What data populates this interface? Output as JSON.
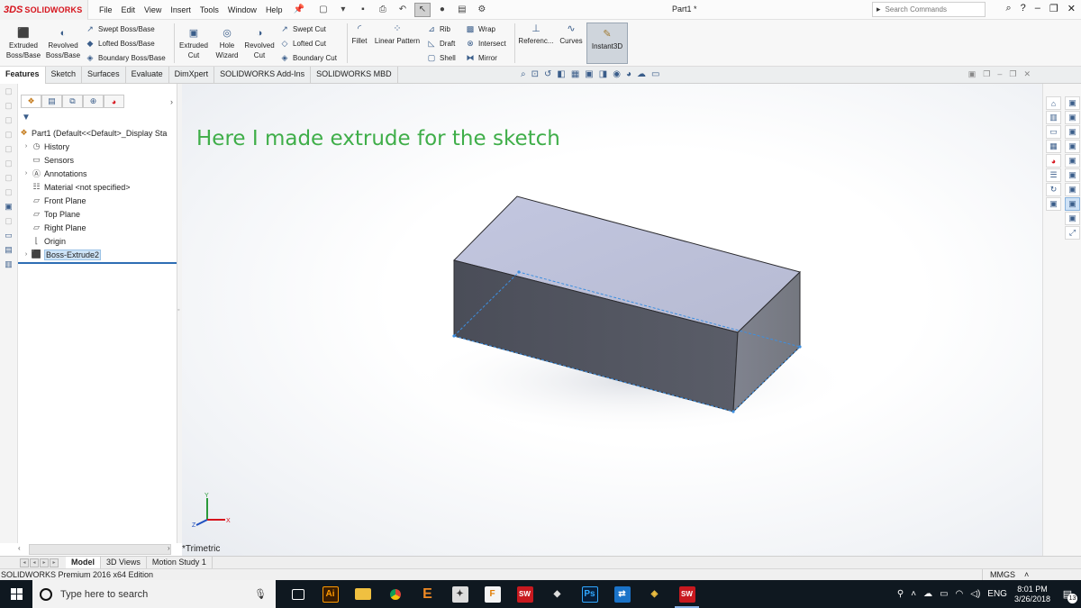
{
  "app": {
    "brand_mark": "3DS",
    "brand_name": "SOLIDWORKS",
    "doc_title": "Part1 *",
    "menu": [
      "File",
      "Edit",
      "View",
      "Insert",
      "Tools",
      "Window",
      "Help"
    ],
    "search_placeholder": "Search Commands"
  },
  "commands": {
    "extruded_boss": "Extruded Boss/Base",
    "extruded_boss_l1": "Extruded",
    "extruded_boss_l2": "Boss/Base",
    "revolved_boss_l1": "Revolved",
    "revolved_boss_l2": "Boss/Base",
    "swept_boss": "Swept Boss/Base",
    "lofted_boss": "Lofted Boss/Base",
    "boundary_boss": "Boundary Boss/Base",
    "extruded_cut_l1": "Extruded",
    "extruded_cut_l2": "Cut",
    "hole_wizard_l1": "Hole",
    "hole_wizard_l2": "Wizard",
    "revolved_cut_l1": "Revolved",
    "revolved_cut_l2": "Cut",
    "swept_cut": "Swept Cut",
    "lofted_cut": "Lofted Cut",
    "boundary_cut": "Boundary Cut",
    "fillet": "Fillet",
    "linear_pattern": "Linear Pattern",
    "rib": "Rib",
    "draft": "Draft",
    "shell": "Shell",
    "wrap": "Wrap",
    "intersect": "Intersect",
    "mirror": "Mirror",
    "reference": "Referenc...",
    "curves": "Curves",
    "instant3d": "Instant3D"
  },
  "tabs": [
    "Features",
    "Sketch",
    "Surfaces",
    "Evaluate",
    "DimXpert",
    "SOLIDWORKS Add-Ins",
    "SOLIDWORKS MBD"
  ],
  "tree": {
    "root": "Part1  (Default<<Default>_Display Sta",
    "items": [
      "History",
      "Sensors",
      "Annotations",
      "Material <not specified>",
      "Front Plane",
      "Top Plane",
      "Right Plane",
      "Origin",
      "Boss-Extrude2"
    ]
  },
  "viewport": {
    "annotation": "Here I made extrude for the sketch",
    "view_name": "*Trimetric",
    "axis_x": "X",
    "axis_y": "Y",
    "axis_z": "Z"
  },
  "bottom_tabs": [
    "Model",
    "3D Views",
    "Motion Study 1"
  ],
  "status": {
    "edition": "SOLIDWORKS Premium 2016 x64 Edition",
    "units": "MMGS"
  },
  "taskbar": {
    "search_placeholder": "Type here to search",
    "language": "ENG",
    "time": "8:01 PM",
    "date": "3/26/2018",
    "notification_count": "13"
  },
  "colors": {
    "annotation_green": "#3fae49",
    "solidworks_red": "#d6121b",
    "selection_blue": "#2e6db4"
  }
}
